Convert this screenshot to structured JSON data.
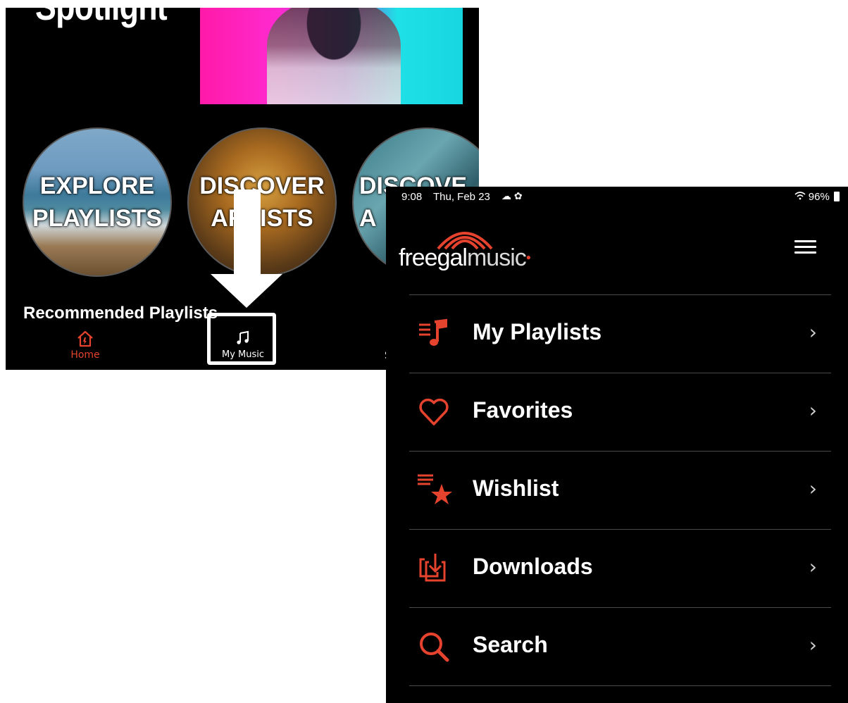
{
  "left_panel": {
    "spotlight_title": "Spotlight",
    "circles": [
      {
        "label": "EXPLORE\nPLAYLISTS"
      },
      {
        "label": "DISCOVER\nARTISTS"
      },
      {
        "label": "DISCOVE\nA"
      }
    ],
    "section_heading": "Recommended Playlists",
    "bottom_nav": {
      "home": {
        "label": "Home",
        "icon": "home-icon"
      },
      "my_music": {
        "label": "My Music",
        "icon": "music-note-icon"
      },
      "partial_label": "S"
    },
    "highlight_color": "#ffffff",
    "arrow_color": "#ffffff"
  },
  "right_panel": {
    "status_bar": {
      "time": "9:08",
      "date": "Thu, Feb 23",
      "icons": "☁ ✿",
      "battery": "96%"
    },
    "logo": {
      "bold": "freegal",
      "light": "music",
      "accent": "#e5432e"
    },
    "menu": [
      {
        "label": "My Playlists",
        "icon": "playlist-icon"
      },
      {
        "label": "Favorites",
        "icon": "heart-icon"
      },
      {
        "label": "Wishlist",
        "icon": "wishlist-star-icon"
      },
      {
        "label": "Downloads",
        "icon": "download-icon"
      },
      {
        "label": "Search",
        "icon": "search-icon"
      }
    ],
    "chevron": "›"
  },
  "colors": {
    "accent": "#e5432e",
    "background": "#000000"
  }
}
